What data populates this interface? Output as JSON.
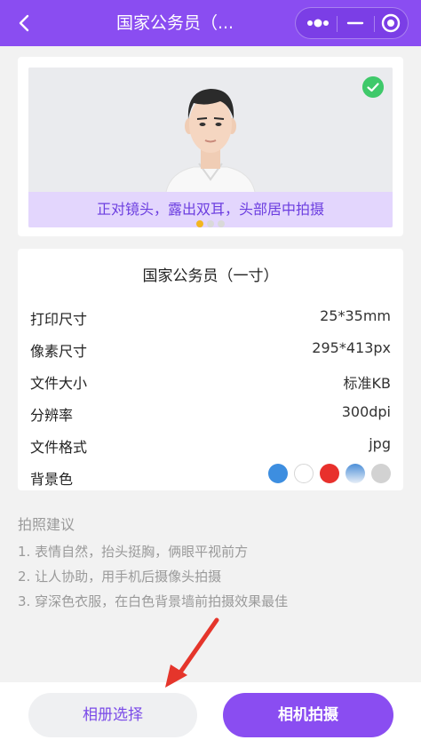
{
  "header": {
    "title": "国家公务员（...",
    "icons": {
      "back": "chevron-left-icon",
      "more": "more-dots-icon",
      "minimize": "minimize-icon",
      "close": "target-circle-icon"
    }
  },
  "banner": {
    "caption": "正对镜头，露出双耳，头部居中拍摄",
    "page_index": 1,
    "page_count": 3
  },
  "spec": {
    "title": "国家公务员（一寸）",
    "rows": [
      {
        "label": "打印尺寸",
        "value": "25*35mm"
      },
      {
        "label": "像素尺寸",
        "value": "295*413px"
      },
      {
        "label": "文件大小",
        "value": "标准KB"
      },
      {
        "label": "分辨率",
        "value": "300dpi"
      },
      {
        "label": "文件格式",
        "value": "jpg"
      },
      {
        "label": "背景色",
        "value": ""
      }
    ],
    "background_colors": [
      "#3d8ee0",
      "#ffffff",
      "#e8302c",
      "gradient-blue-white",
      "#d2d2d2"
    ]
  },
  "tips": {
    "title": "拍照建议",
    "items": [
      "1. 表情自然，抬头挺胸，俩眼平视前方",
      "2. 让人协助，用手机后摄像头拍摄",
      "3. 穿深色衣服，在白色背景墙前拍摄效果最佳"
    ]
  },
  "actions": {
    "album": "相册选择",
    "camera": "相机拍摄"
  },
  "colors": {
    "brand": "#8a4df1",
    "accent_arrow": "#e5352b"
  }
}
